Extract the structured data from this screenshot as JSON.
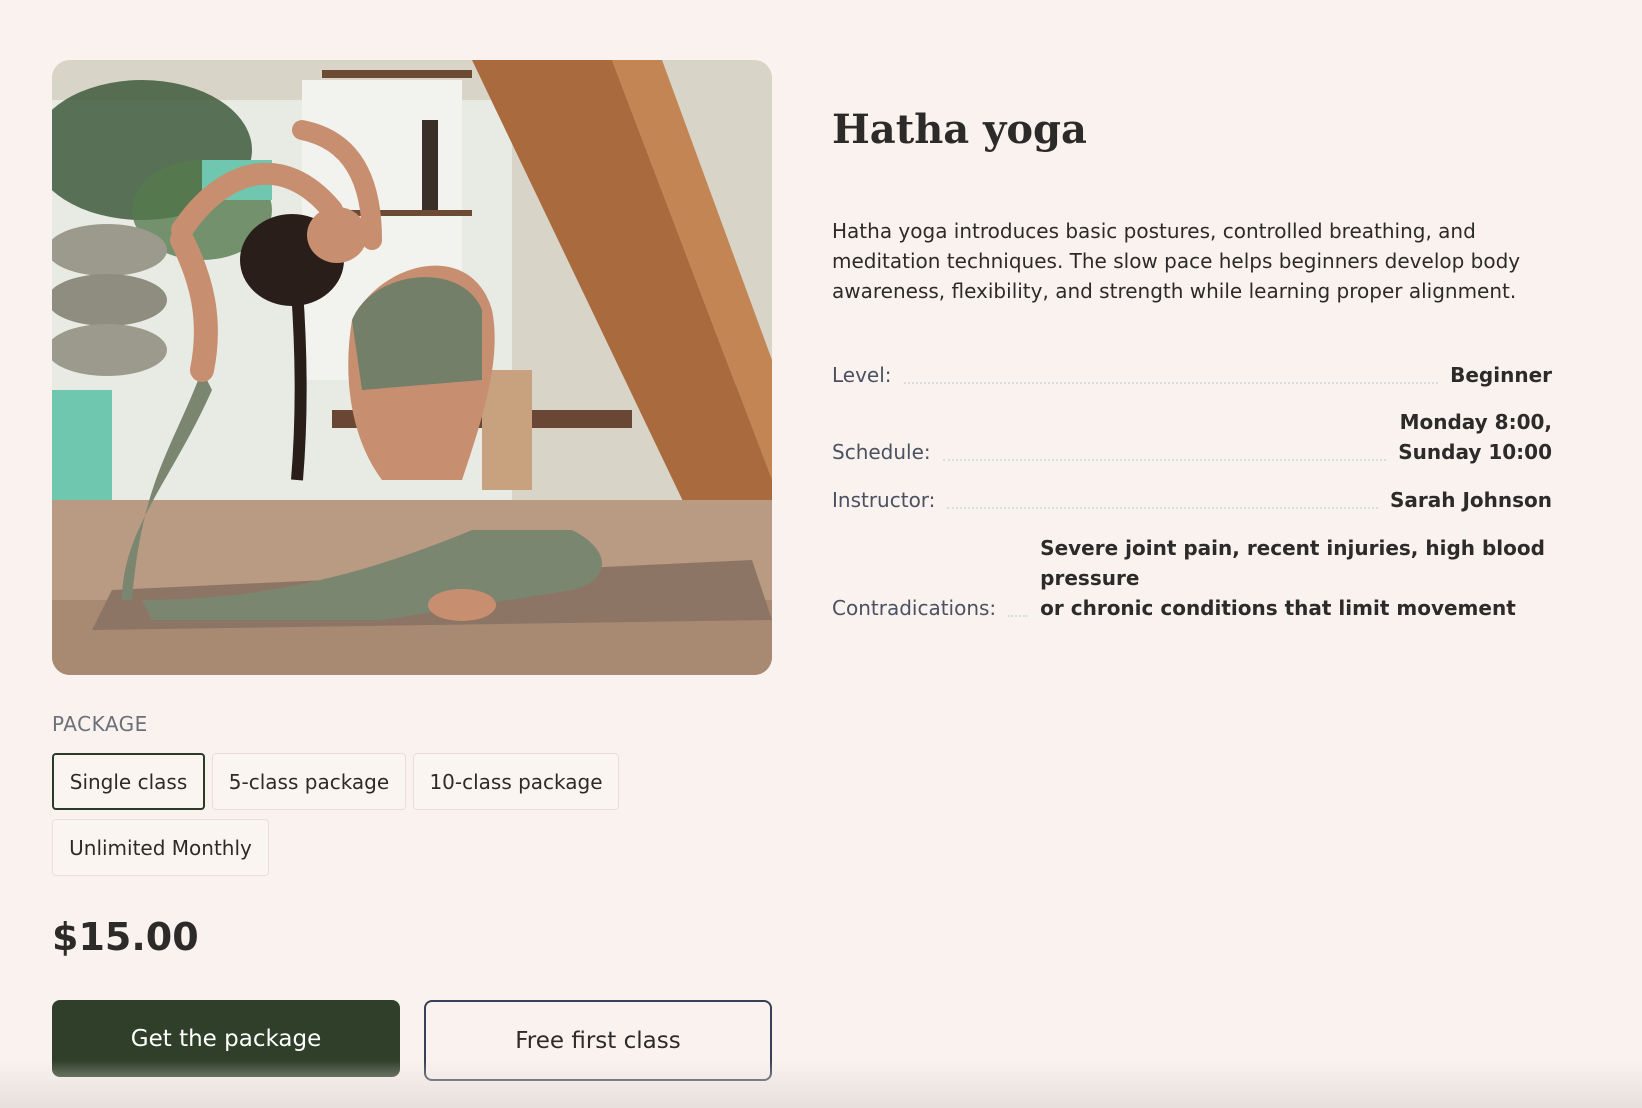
{
  "class": {
    "title": "Hatha yoga",
    "description": "Hatha yoga introduces basic postures, controlled breathing, and meditation techniques. The slow pace helps beginners develop body awareness, flexibility, and strength while learning proper alignment."
  },
  "details": [
    {
      "label": "Level:",
      "value": "Beginner"
    },
    {
      "label": "Schedule:",
      "value": "Monday 8:00,\nSunday 10:00"
    },
    {
      "label": "Instructor:",
      "value": "Sarah Johnson"
    },
    {
      "label": "Contradications:",
      "value": "Severe joint pain, recent injuries, high blood pressure\nor chronic conditions that limit movement"
    }
  ],
  "package": {
    "label": "PACKAGE",
    "options": [
      {
        "label": "Single class",
        "selected": true
      },
      {
        "label": "5-class package",
        "selected": false
      },
      {
        "label": "10-class package",
        "selected": false
      },
      {
        "label": "Unlimited Monthly",
        "selected": false
      }
    ]
  },
  "price": "$15.00",
  "actions": {
    "primary": "Get the package",
    "secondary": "Free first class"
  },
  "colors": {
    "background": "#faf2ef",
    "primary_button": "#2f3f29",
    "selected_border": "#2c3b27",
    "outfit": "#7b8670"
  }
}
